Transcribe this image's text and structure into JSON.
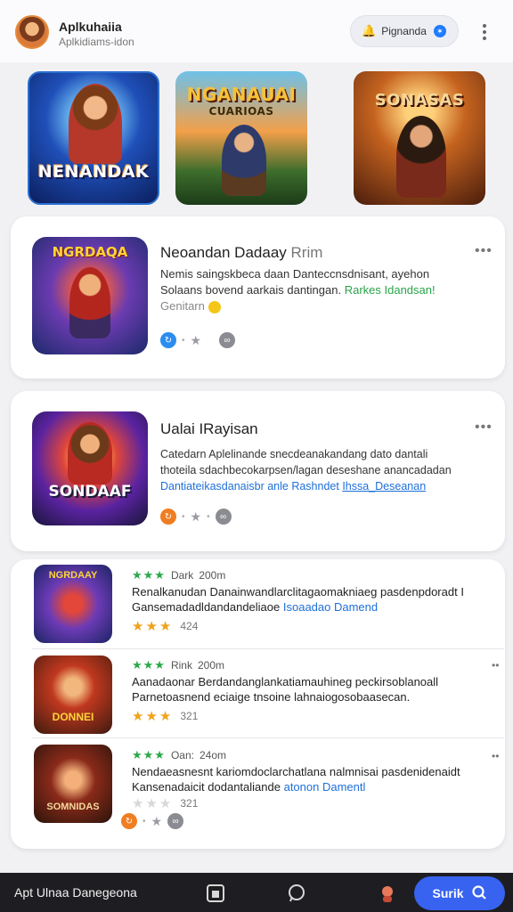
{
  "header": {
    "title": "Aplkuhaiia",
    "subtitle": "Aplkidiams-idon",
    "search_label": "Pignanda",
    "badge_icon": "messenger-icon",
    "menu_icon": "kebab-menu-icon"
  },
  "hero": [
    {
      "art_text": "NENANDAK",
      "icon": "cowboy-hero-art"
    },
    {
      "art_text": "NGANAUAI",
      "art_sub": "CUARIOAS",
      "icon": "battle-scene-art"
    },
    {
      "art_text": "SONASAS",
      "icon": "gunslinger-art"
    }
  ],
  "featured": [
    {
      "title": "Neoandan Dadaay",
      "title_suffix": "Rrim",
      "desc_line1": "Nemis saingskbeca daan Danteccnsdnisant, ayehon",
      "desc_line2_prefix": "Solaans bovend aarkais dantingan.",
      "desc_line2_link": "Rarkes Idandsan!",
      "desc_line3": "Genitarn",
      "art_text": "NGRDAQA"
    },
    {
      "title": "Ualai IRayisan",
      "desc_line1": "Catedarn Aplelinande snecdeanakandang dato dantali",
      "desc_line2": "thoteila sdachbecokarpsen/lagan deseshane anancadadan",
      "desc_line3_a": "Dantiateikasdanaisbr anle",
      "desc_line3_b": "Rashndet",
      "desc_line3_c": "Ihssa_Deseanan",
      "art_text": "SONDAAF"
    }
  ],
  "list": [
    {
      "rank_label": "Dark",
      "size": "200m",
      "desc_line1": "Renalkanudan Danainwandlarclitagaomakniaeg pasdenpdoradt I",
      "desc_line2_prefix": "Gansemadadldandandeliaoe",
      "desc_line2_link": "Isoaadao Damend",
      "rating": "424",
      "art_text": "NGRDAAY"
    },
    {
      "rank_label": "Rink",
      "size": "200m",
      "desc_line1": "Aanadaonar Berdandanglankatiamauhineg peckirsoblanoall",
      "desc_line2": "Parnetoasnend eciaige tnsoine lahnaiogosobaasecan.",
      "rating": "321",
      "art_text": "DONNEI"
    },
    {
      "rank_label": "Oan:",
      "size": "24om",
      "desc_line1": "Nendaeasnesnt kariomdoclarchatlana nalmnisai pasdenidenaidt",
      "desc_line2_prefix": "Kansenadaicit dodantaliande",
      "desc_line2_link": "atonon Damentl",
      "rating": "321",
      "art_text": "SOMNIDAS"
    }
  ],
  "bottom": {
    "label": "Apt Ulnaa Danegeona",
    "cta_label": "Surik"
  },
  "colors": {
    "accent": "#3763f0",
    "green": "#2aa34a",
    "gold": "#f0a31a",
    "link_blue": "#1e6fd9"
  }
}
